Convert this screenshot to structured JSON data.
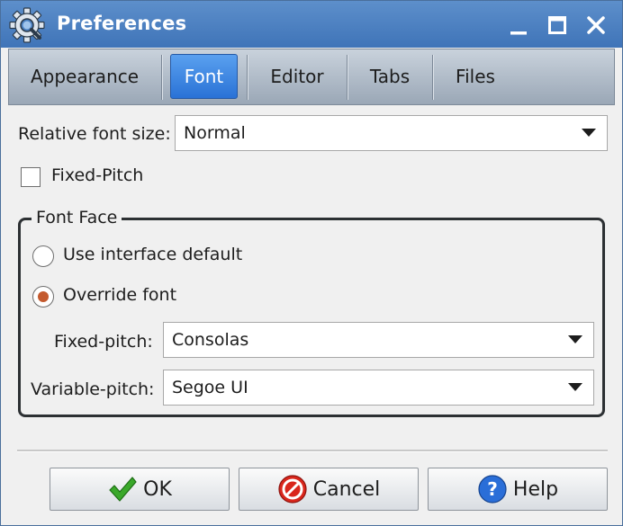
{
  "window": {
    "title": "Preferences"
  },
  "tabs": [
    {
      "label": "Appearance",
      "active": false
    },
    {
      "label": "Font",
      "active": true
    },
    {
      "label": "Editor",
      "active": false
    },
    {
      "label": "Tabs",
      "active": false
    },
    {
      "label": "Files",
      "active": false
    }
  ],
  "relative_font_size": {
    "label": "Relative font size:",
    "value": "Normal"
  },
  "fixed_pitch_checkbox": {
    "label": "Fixed-Pitch",
    "checked": false
  },
  "font_face": {
    "title": "Font Face",
    "options": [
      {
        "label": "Use interface default",
        "selected": false
      },
      {
        "label": "Override font",
        "selected": true
      }
    ],
    "fixed_pitch": {
      "label": "Fixed-pitch:",
      "value": "Consolas"
    },
    "variable_pitch": {
      "label": "Variable-pitch:",
      "value": "Segoe UI"
    }
  },
  "buttons": {
    "ok": {
      "label": "OK",
      "icon": "checkmark-icon"
    },
    "cancel": {
      "label": "Cancel",
      "icon": "cancel-icon"
    },
    "help": {
      "label": "Help",
      "icon": "help-icon"
    }
  },
  "colors": {
    "titlebar": "#4a7fc0",
    "active_tab": "#3d86e3",
    "radio_dot": "#c45a2e",
    "ok_check": "#3aa82a",
    "cancel_red": "#d9261c",
    "help_blue": "#2a6ed8"
  }
}
